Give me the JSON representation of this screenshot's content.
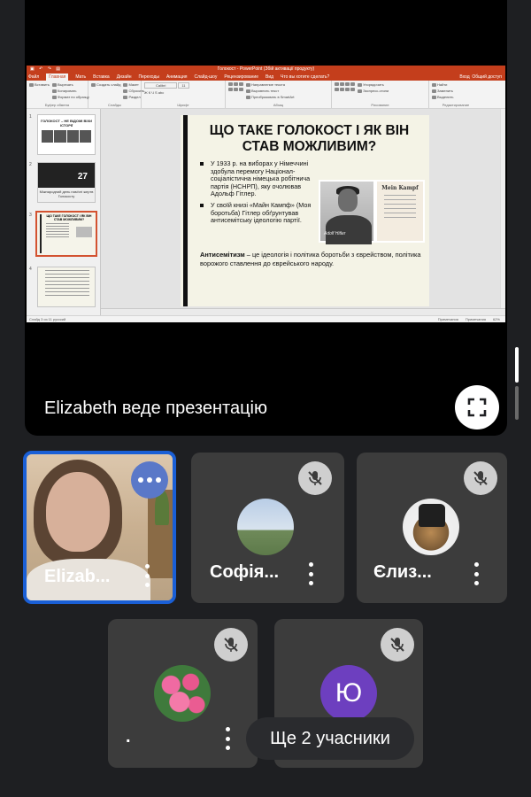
{
  "presentation": {
    "window_title": "Голокост - PowerPoint (Збій активації продукту)",
    "menu": [
      "Файл",
      "Главная",
      "Мать",
      "Вставка",
      "Дизайн",
      "Переходы",
      "Анимация",
      "Слайд-шоу",
      "Рецензирование",
      "Вид"
    ],
    "search_hint": "Что вы хотите сделать?",
    "menu_right": [
      "Вход",
      "Общий доступ"
    ],
    "ribbon_groups": [
      {
        "label": "Буфер обмена",
        "items": [
          "Вставить",
          "Вырезать",
          "Копировать",
          "Формат по образцу"
        ]
      },
      {
        "label": "Слайды",
        "items": [
          "Создать слайд",
          "Макет",
          "Сбросить",
          "Раздел"
        ]
      },
      {
        "label": "Шрифт",
        "items": [
          "Calibri",
          "11"
        ]
      },
      {
        "label": "Абзац",
        "items": [
          "Направление текста",
          "Выровнять текст",
          "Преобразовать в SmartArt"
        ]
      },
      {
        "label": "Рисование",
        "items": [
          "Упорядочить",
          "Экспресс-стили"
        ]
      },
      {
        "label": "Редактирование",
        "items": [
          "Найти",
          "Заменить",
          "Выделить"
        ]
      }
    ],
    "thumbnails": [
      {
        "num": "1",
        "title": "ГОЛОКОСТ – НЕ ВІДОМІ ВІХИ ІСТОРІЇ"
      },
      {
        "num": "2",
        "big_number": "27",
        "caption": "Міжнародний день пам'яті жертв Голокосту"
      },
      {
        "num": "3",
        "title": "ЩО ТАКЕ ГОЛОКОСТ І ЯК ВІН СТАВ МОЖЛИВИМ?"
      },
      {
        "num": "4"
      }
    ],
    "slide": {
      "title": "ЩО ТАКЕ ГОЛОКОСТ І ЯК ВІН СТАВ МОЖЛИВИМ?",
      "bullets": [
        "У 1933 р. на виборах у Німеччині здобула перемогу Націонал-соціалістична німецька робітнича партія (НСНРП), яку очолював Адольф Гітлер.",
        "У своїй книзі «Майн Кампф» (Моя боротьба) Гітлер обґрунтував антисемітську ідеологію партії."
      ],
      "definition_term": "Антисемітизм",
      "definition_text": " – це ідеологія і політика боротьби з єврейством, політика ворожого ставлення до єврейського народу.",
      "book_title": "Mein Kampf",
      "photo_caption": "Adolf Hitler"
    },
    "status_left": "Слайд 3 из 11   русский",
    "status_right": [
      "Примечания",
      "Примечания",
      "62%"
    ]
  },
  "presenting_label": "Elizabeth веде презентацію",
  "participants": [
    {
      "name": "Elizab...",
      "muted": false,
      "active": true
    },
    {
      "name": "Софія...",
      "muted": true
    },
    {
      "name": "Єлиз...",
      "muted": true
    },
    {
      "name": ".",
      "muted": true
    },
    {
      "name": "",
      "initial": "Ю",
      "muted": true
    }
  ],
  "more_participants": "Ще 2 учасники",
  "colors": {
    "background": "#1e1f22",
    "tile": "#3c3c3c",
    "active_border": "#1a5fd6",
    "ppt_accent": "#c43e1c",
    "avatar_letter_bg": "#6d3fbf"
  }
}
